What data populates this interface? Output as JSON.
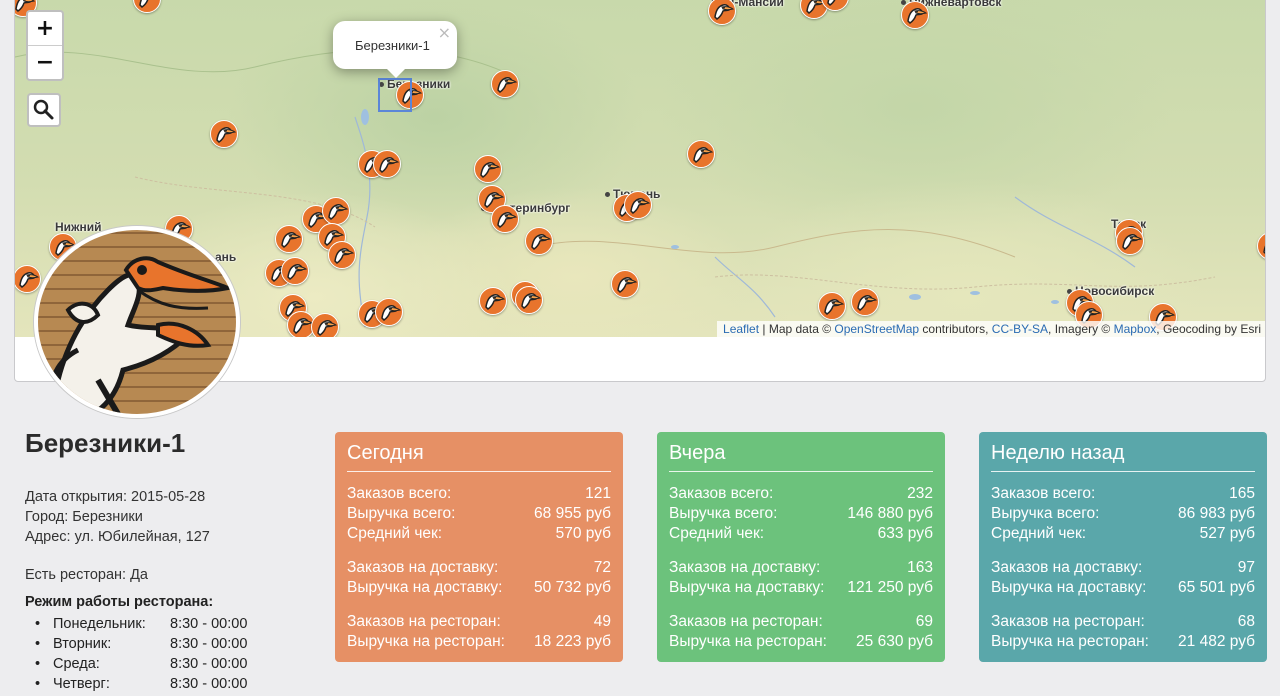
{
  "map": {
    "zoom_in": "+",
    "zoom_out": "−",
    "search_icon": "magnifier-icon",
    "popup": {
      "title": "Березники-1",
      "close": "×"
    },
    "cities": [
      "нты-Мансий",
      "Нижневартовск",
      "Березники",
      "Екатеринбург",
      "Тюмень",
      "Нижний",
      "ань",
      "Томск",
      "Новосибирск"
    ],
    "attribution": {
      "leaflet": "Leaflet",
      "sep1": " | Map data © ",
      "osm": "OpenStreetMap",
      "sep2": " contributors, ",
      "license": "CC-BY-SA",
      "sep3": ", Imagery © ",
      "mapbox": "Mapbox",
      "sep4": ", Geocoding by Esri"
    }
  },
  "shop": {
    "name": "Березники-1",
    "opened": "Дата открытия: 2015-05-28",
    "city": "Город: Березники",
    "address": "Адрес: ул. Юбилейная, 127",
    "has_restaurant": "Есть ресторан: Да",
    "hours_title": "Режим работы ресторана:",
    "hours": [
      {
        "day": "Понедельник:",
        "time": "8:30 - 00:00"
      },
      {
        "day": "Вторник:",
        "time": "8:30 - 00:00"
      },
      {
        "day": "Среда:",
        "time": "8:30 - 00:00"
      },
      {
        "day": "Четверг:",
        "time": "8:30 - 00:00"
      }
    ]
  },
  "labels": {
    "orders_total": "Заказов всего:",
    "revenue_total": "Выручка всего:",
    "avg_check": "Средний чек:",
    "orders_delivery": "Заказов на доставку:",
    "revenue_delivery": "Выручка на доставку:",
    "orders_restaurant": "Заказов на ресторан:",
    "revenue_restaurant": "Выручка на ресторан:"
  },
  "cards": [
    {
      "title": "Сегодня",
      "color": "#e69065",
      "orders_total": "121",
      "revenue_total": "68 955 руб",
      "avg_check": "570 руб",
      "orders_delivery": "72",
      "revenue_delivery": "50 732 руб",
      "orders_restaurant": "49",
      "revenue_restaurant": "18 223 руб"
    },
    {
      "title": "Вчера",
      "color": "#6cc27c",
      "orders_total": "232",
      "revenue_total": "146 880 руб",
      "avg_check": "633 руб",
      "orders_delivery": "163",
      "revenue_delivery": "121 250 руб",
      "orders_restaurant": "69",
      "revenue_restaurant": "25 630 руб"
    },
    {
      "title": "Неделю назад",
      "color": "#5aa7aa",
      "orders_total": "165",
      "revenue_total": "86 983 руб",
      "avg_check": "527 руб",
      "orders_delivery": "97",
      "revenue_delivery": "65 501 руб",
      "orders_restaurant": "68",
      "revenue_restaurant": "21 482 руб"
    }
  ]
}
